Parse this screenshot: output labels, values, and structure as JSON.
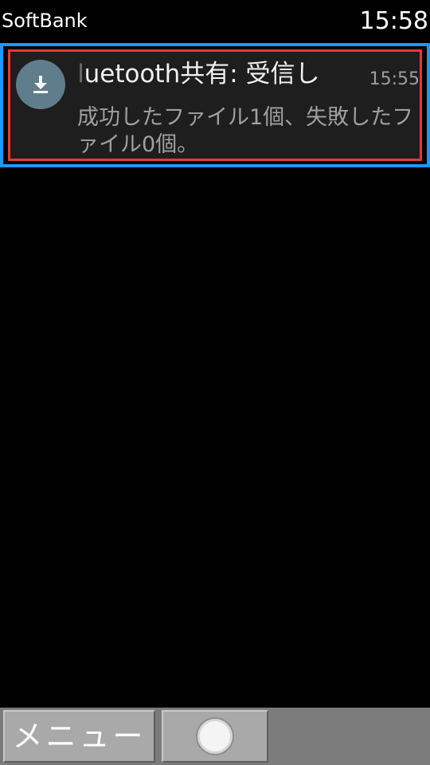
{
  "status_bar": {
    "carrier": "SoftBank",
    "time": "15:58"
  },
  "notification": {
    "icon": "download-icon",
    "title": "luetooth共有: 受信し",
    "time": "15:55",
    "body": "成功したファイル1個、失敗したファイル0個。"
  },
  "bottom_bar": {
    "menu_label": "メニュー",
    "center_icon": "circle-icon"
  },
  "colors": {
    "focus_outline": "#2196f3",
    "selection_outline": "#e53935",
    "icon_background": "#607d8b",
    "card_background": "#1e1e1e",
    "softkey_background": "#a9a9a9"
  }
}
